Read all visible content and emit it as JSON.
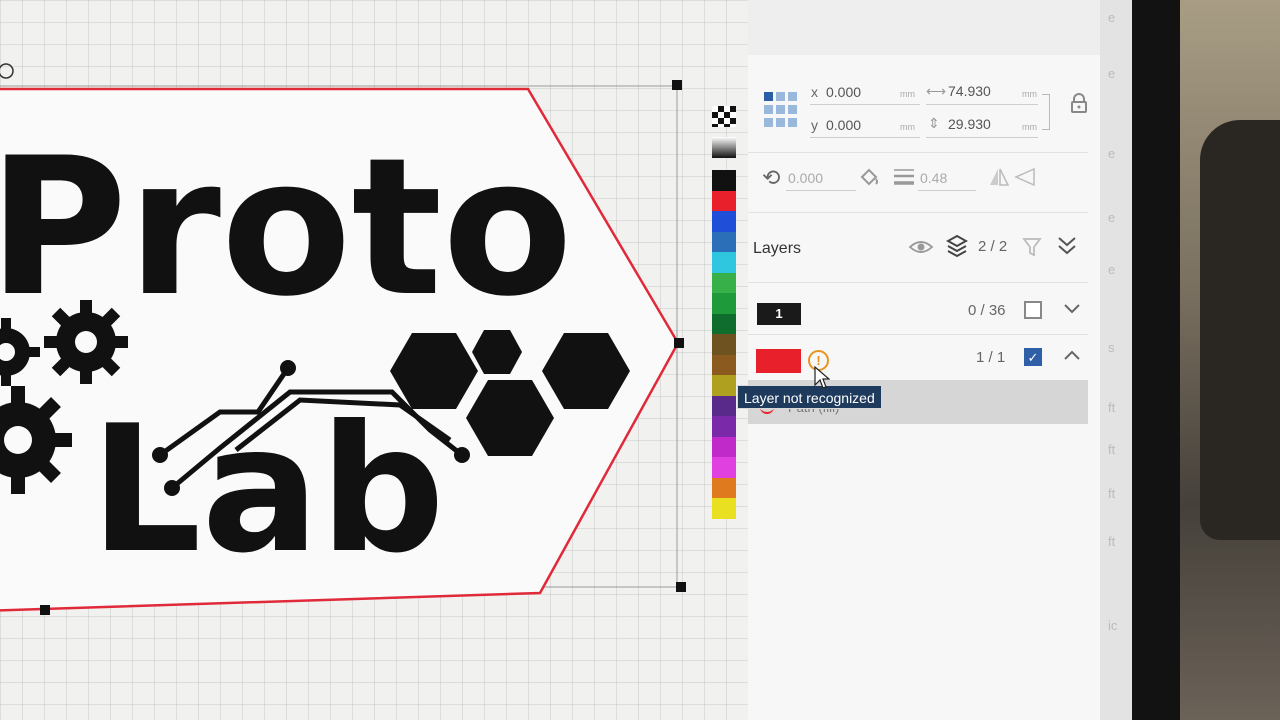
{
  "transform": {
    "x_label": "x",
    "x_value": "0.000",
    "x_unit": "mm",
    "y_label": "y",
    "y_value": "0.000",
    "y_unit": "mm",
    "width_value": "74.930",
    "width_unit": "mm",
    "height_value": "29.930",
    "height_unit": "mm",
    "rotation_value": "0.000",
    "line_width_value": "0.48"
  },
  "layers": {
    "title": "Layers",
    "count": "2 / 2",
    "items": [
      {
        "label": "1",
        "count": "0 / 36",
        "checked": false,
        "expanded": false
      },
      {
        "label": "",
        "color": "#e8202c",
        "count": "1 / 1",
        "checked": true,
        "expanded": true
      }
    ],
    "sublayer_label": "Path (fill)"
  },
  "tooltip": {
    "text": "Layer not recognized"
  },
  "artwork": {
    "line1": "Proto",
    "line2": "Lab"
  },
  "palette": {
    "colors": [
      "#111111",
      "#e8202c",
      "#1f4fd8",
      "#2a6fb8",
      "#2fc7e0",
      "#38b04a",
      "#1f9a3a",
      "#0f6e2e",
      "#6e5320",
      "#8a5a1e",
      "#b0a020",
      "#5a2a8a",
      "#7a2aa8",
      "#c02ac8",
      "#e040e0",
      "#e07a1e",
      "#e8e020"
    ]
  },
  "edge_letters": [
    "e",
    "e",
    "e",
    "e",
    "e",
    "s",
    "ft",
    "ft",
    "ft",
    "ft",
    "ic"
  ]
}
